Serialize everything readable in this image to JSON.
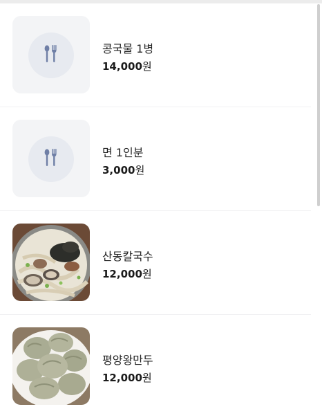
{
  "menu": {
    "items": [
      {
        "name": "콩국물 1병",
        "price": "14,000",
        "unit": "원",
        "image": "placeholder-utensils-icon"
      },
      {
        "name": "면 1인분",
        "price": "3,000",
        "unit": "원",
        "image": "placeholder-utensils-icon"
      },
      {
        "name": "산동칼국수",
        "price": "12,000",
        "unit": "원",
        "image": "kalguksu-photo"
      },
      {
        "name": "평양왕만두",
        "price": "12,000",
        "unit": "원",
        "image": "dumplings-photo"
      }
    ]
  },
  "colors": {
    "placeholder_bg": "#f3f4f6",
    "placeholder_circle": "#e7eaf0",
    "icon": "#6f7fa6",
    "divider": "#f0f0f2"
  }
}
